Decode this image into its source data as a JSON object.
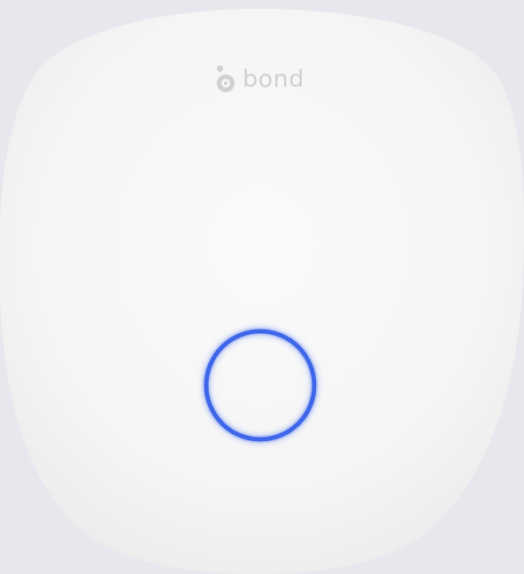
{
  "brand": {
    "name": "bond",
    "logo_icon": "bond-logo-icon",
    "logo_color": "#d0d0d0"
  },
  "device": {
    "body_color": "#f6f6f6",
    "background_color": "#e7e8ed"
  },
  "indicator": {
    "icon": "led-ring-icon",
    "color": "#3d66e8",
    "glow_color": "#6f8ff5"
  }
}
